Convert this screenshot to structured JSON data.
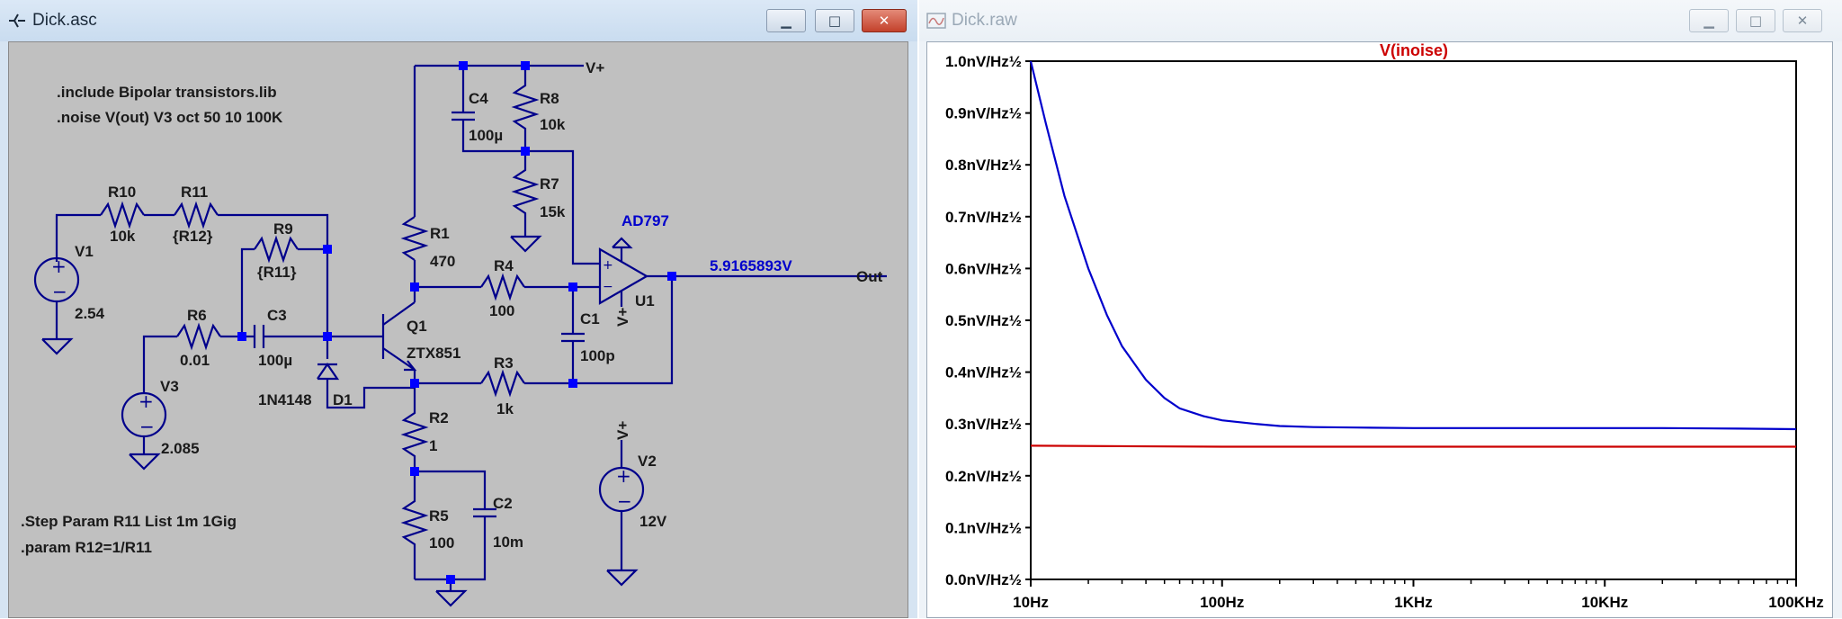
{
  "schematic_window": {
    "title": "Dick.asc",
    "buttons": {
      "minimize": "▁",
      "maximize": "□",
      "close": "✕"
    },
    "directives": [
      ".include Bipolar transistors.lib",
      ".noise V(out) V3 oct 50 10 100K",
      ".Step Param R11 List 1m 1Gig",
      ".param R12=1/R11"
    ],
    "labels": {
      "r10_name": "R10",
      "r10_value": "10k",
      "r11_name": "R11",
      "r11_value": "{R12}",
      "r9_name": "R9",
      "r9_value": "{R11}",
      "v1_name": "V1",
      "v1_value": "2.54",
      "r6_name": "R6",
      "r6_value": "0.01",
      "c3_name": "C3",
      "c3_value": "100µ",
      "v3_name": "V3",
      "v3_value": "2.085",
      "d1_part": "1N4148",
      "d1_name": "D1",
      "q1_name": "Q1",
      "q1_part": "ZTX851",
      "r1_name": "R1",
      "r1_value": "470",
      "c4_name": "C4",
      "c4_value": "100µ",
      "r8_name": "R8",
      "r8_value": "10k",
      "r7_name": "R7",
      "r7_value": "15k",
      "r4_name": "R4",
      "r4_value": "100",
      "r3_name": "R3",
      "r3_value": "1k",
      "r2_name": "R2",
      "r2_value": "1",
      "r5_name": "R5",
      "r5_value": "100",
      "c2_name": "C2",
      "c2_value": "10m",
      "c1_name": "C1",
      "c1_value": "100p",
      "u1_name": "U1",
      "u1_part": "AD797",
      "v2_name": "V2",
      "v2_value": "12V",
      "vplus_top": "V+",
      "vplus_v2": "V+",
      "opamp_vplus": "V+",
      "out_label": "Out",
      "out_voltage": "5.9165893V"
    },
    "colors": {
      "wire": "#00008b",
      "node": "#0000ff",
      "background": "#c0c0c0",
      "annotation_blue": "#0000cc"
    }
  },
  "waveform_window": {
    "title": "Dick.raw",
    "buttons": {
      "minimize": "▁",
      "maximize": "□",
      "close": "✕"
    }
  },
  "chart_data": {
    "type": "line",
    "title": "V(inoise)",
    "x_scale": "log",
    "xlim": [
      10,
      100000
    ],
    "ylim": [
      0,
      1.0
    ],
    "x_ticks": [
      "10Hz",
      "100Hz",
      "1KHz",
      "10KHz",
      "100KHz"
    ],
    "y_ticks": [
      "0.0nV/Hz½",
      "0.1nV/Hz½",
      "0.2nV/Hz½",
      "0.3nV/Hz½",
      "0.4nV/Hz½",
      "0.5nV/Hz½",
      "0.6nV/Hz½",
      "0.7nV/Hz½",
      "0.8nV/Hz½",
      "0.9nV/Hz½",
      "1.0nV/Hz½"
    ],
    "grid": false,
    "series": [
      {
        "color": "#0000cc",
        "x": [
          10,
          12,
          15,
          20,
          25,
          30,
          40,
          50,
          60,
          80,
          100,
          150,
          200,
          300,
          500,
          1000,
          2000,
          5000,
          10000,
          20000,
          50000,
          100000
        ],
        "y": [
          1.0,
          0.88,
          0.74,
          0.6,
          0.51,
          0.45,
          0.385,
          0.35,
          0.33,
          0.315,
          0.307,
          0.3,
          0.296,
          0.294,
          0.293,
          0.292,
          0.292,
          0.292,
          0.292,
          0.292,
          0.291,
          0.29
        ]
      },
      {
        "color": "#cc0000",
        "x": [
          10,
          100,
          1000,
          10000,
          100000
        ],
        "y": [
          0.258,
          0.256,
          0.256,
          0.256,
          0.256
        ]
      }
    ],
    "colors": {
      "title": "#cc0000",
      "axis": "#000000"
    }
  }
}
